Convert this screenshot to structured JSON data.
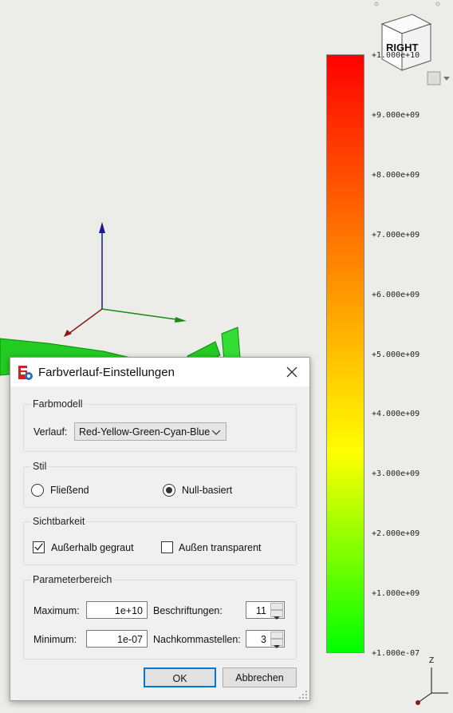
{
  "scale": {
    "labels": [
      "+1.000e+10",
      "+9.000e+09",
      "+8.000e+09",
      "+7.000e+09",
      "+6.000e+09",
      "+5.000e+09",
      "+4.000e+09",
      "+3.000e+09",
      "+2.000e+09",
      "+1.000e+09",
      "+1.000e-07"
    ],
    "gradient": [
      "#ff0000",
      "#ff8000",
      "#ffff00",
      "#00ff00"
    ]
  },
  "navcube": {
    "face_label": "RIGHT"
  },
  "axes_label": "Z",
  "dialog": {
    "title": "Farbverlauf-Einstellungen",
    "farbmodell": {
      "title": "Farbmodell",
      "verlauf_label": "Verlauf:",
      "verlauf_value": "Red-Yellow-Green-Cyan-Blue"
    },
    "stil": {
      "title": "Stil",
      "option_1": "Fließend",
      "option_2": "Null-basiert",
      "selected": "Null-basiert"
    },
    "sichtbarkeit": {
      "title": "Sichtbarkeit",
      "option_1": "Außerhalb gegraut",
      "option_1_checked": true,
      "option_2": "Außen transparent",
      "option_2_checked": false
    },
    "parameterbereich": {
      "title": "Parameterbereich",
      "maximum_label": "Maximum:",
      "maximum_value": "1e+10",
      "minimum_label": "Minimum:",
      "minimum_value": "1e-07",
      "beschriftungen_label": "Beschriftungen:",
      "beschriftungen_value": "11",
      "nachkomma_label": "Nachkommastellen:",
      "nachkomma_value": "3"
    },
    "ok_label": "OK",
    "cancel_label": "Abbrechen"
  }
}
